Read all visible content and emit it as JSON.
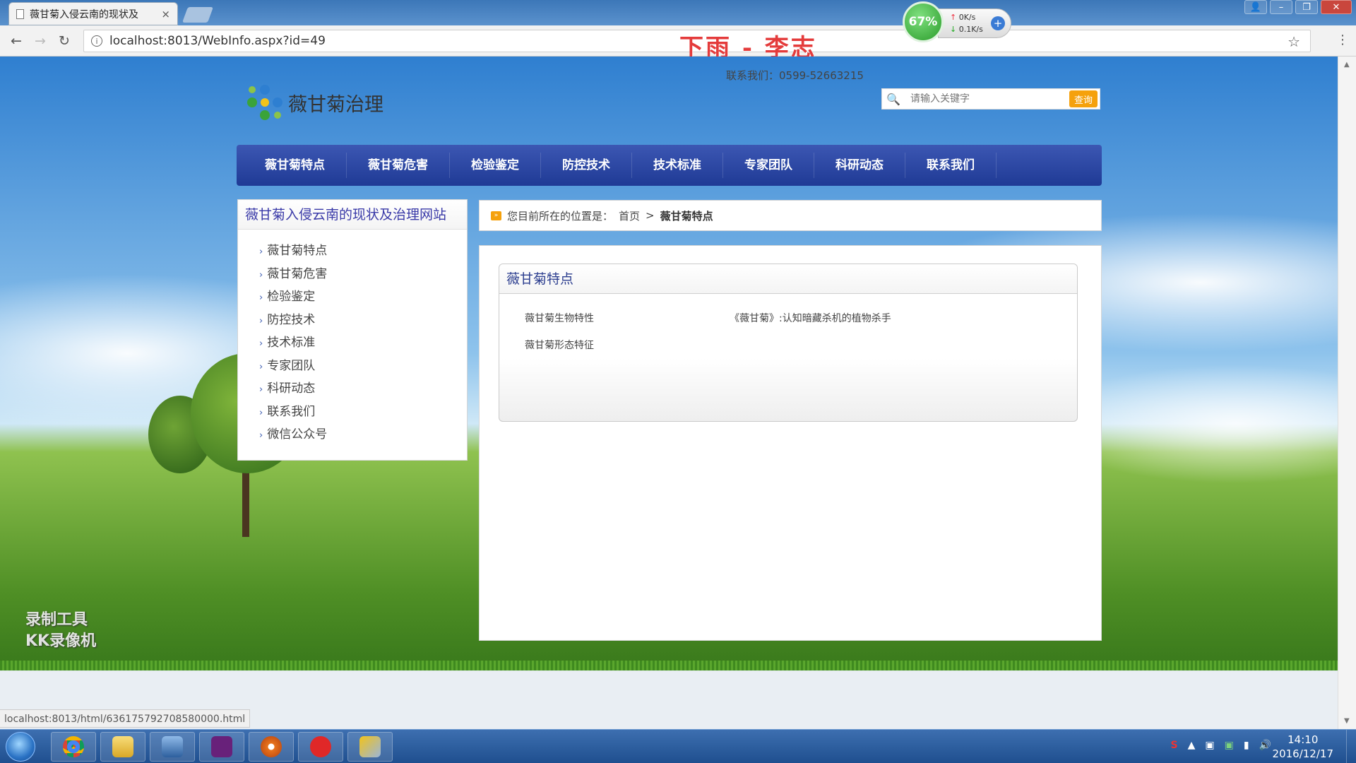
{
  "browser": {
    "tab_title": "薇甘菊入侵云南的现状及",
    "tab_close": "×",
    "address": "localhost:8013/WebInfo.aspx?id=49",
    "status_url": "localhost:8013/html/636175792708580000.html"
  },
  "overlays": {
    "song": "下雨 - 李志",
    "net_percent": "67%",
    "net_up": "0K/s",
    "net_down": "0.1K/s",
    "watermark_line1": "录制工具",
    "watermark_line2": "KK录像机"
  },
  "site": {
    "contact": "联系我们：0599-52663215",
    "logo_text": "薇甘菊治理",
    "search_placeholder": "请输入关键字",
    "search_button": "查询",
    "nav": [
      "薇甘菊特点",
      "薇甘菊危害",
      "检验鉴定",
      "防控技术",
      "技术标准",
      "专家团队",
      "科研动态",
      "联系我们"
    ]
  },
  "sidebar": {
    "title": "薇甘菊入侵云南的现状及治理网站",
    "items": [
      "薇甘菊特点",
      "薇甘菊危害",
      "检验鉴定",
      "防控技术",
      "技术标准",
      "专家团队",
      "科研动态",
      "联系我们",
      "微信公众号"
    ]
  },
  "breadcrumb": {
    "prefix": "您目前所在的位置是：",
    "home": "首页",
    "separator": ">",
    "current": "薇甘菊特点"
  },
  "panel": {
    "title": "薇甘菊特点",
    "links": [
      "薇甘菊生物特性",
      "《薇甘菊》:认知暗藏杀机的植物杀手",
      "薇甘菊形态特征"
    ]
  },
  "taskbar": {
    "time": "14:10",
    "date": "2016/12/17"
  },
  "colors": {
    "nav_bg": "#1f3a95",
    "accent_orange": "#f5a10c",
    "sidebar_title": "#3a3aa8"
  }
}
